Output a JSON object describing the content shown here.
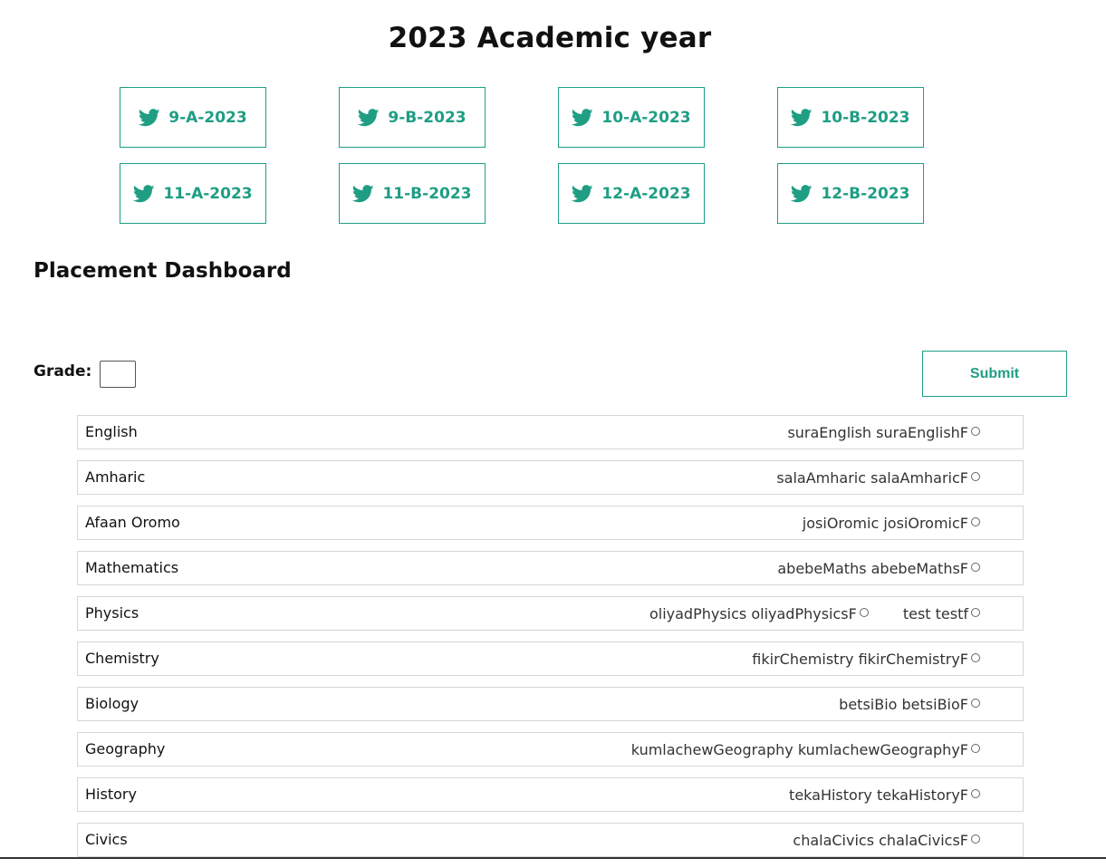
{
  "page_title": "2023 Academic year",
  "class_buttons": [
    {
      "label": "9-A-2023",
      "icon": "twitter-bird-icon"
    },
    {
      "label": "9-B-2023",
      "icon": "twitter-bird-icon"
    },
    {
      "label": "10-A-2023",
      "icon": "twitter-bird-icon"
    },
    {
      "label": "10-B-2023",
      "icon": "twitter-bird-icon"
    },
    {
      "label": "11-A-2023",
      "icon": "twitter-bird-icon"
    },
    {
      "label": "11-B-2023",
      "icon": "twitter-bird-icon"
    },
    {
      "label": "12-A-2023",
      "icon": "twitter-bird-icon"
    },
    {
      "label": "12-B-2023",
      "icon": "twitter-bird-icon"
    }
  ],
  "section_title": "Placement Dashboard",
  "grade": {
    "label": "Grade:",
    "value": ""
  },
  "submit_label": "Submit",
  "colors": {
    "accent": "#1f9e84",
    "border": "#d6d6d6",
    "text": "#111111"
  },
  "subjects": [
    {
      "name": "English",
      "teachers": [
        "suraEnglish suraEnglishF"
      ]
    },
    {
      "name": "Amharic",
      "teachers": [
        "salaAmharic salaAmharicF"
      ]
    },
    {
      "name": "Afaan Oromo",
      "teachers": [
        "josiOromic josiOromicF"
      ]
    },
    {
      "name": "Mathematics",
      "teachers": [
        "abebeMaths abebeMathsF"
      ]
    },
    {
      "name": "Physics",
      "teachers": [
        "oliyadPhysics oliyadPhysicsF",
        "test testf"
      ]
    },
    {
      "name": "Chemistry",
      "teachers": [
        "fikirChemistry fikirChemistryF"
      ]
    },
    {
      "name": "Biology",
      "teachers": [
        "betsiBio betsiBioF"
      ]
    },
    {
      "name": "Geography",
      "teachers": [
        "kumlachewGeography kumlachewGeographyF"
      ]
    },
    {
      "name": "History",
      "teachers": [
        "tekaHistory tekaHistoryF"
      ]
    },
    {
      "name": "Civics",
      "teachers": [
        "chalaCivics chalaCivicsF"
      ]
    }
  ]
}
